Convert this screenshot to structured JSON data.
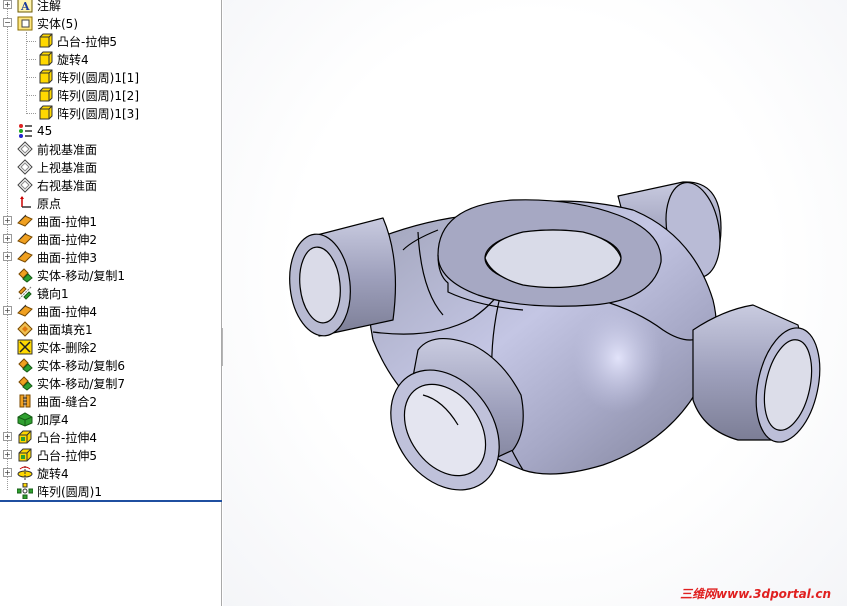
{
  "tree": {
    "items": [
      {
        "label": "注解",
        "icon": "annotation-icon"
      },
      {
        "label": "实体(5)",
        "icon": "solid-bodies-folder-icon"
      },
      {
        "label": "凸台-拉伸5",
        "icon": "solid-body-icon"
      },
      {
        "label": "旋转4",
        "icon": "solid-body-icon"
      },
      {
        "label": "阵列(圆周)1[1]",
        "icon": "solid-body-icon"
      },
      {
        "label": "阵列(圆周)1[2]",
        "icon": "solid-body-icon"
      },
      {
        "label": "阵列(圆周)1[3]",
        "icon": "solid-body-icon"
      },
      {
        "label": "45",
        "icon": "material-icon"
      },
      {
        "label": "前视基准面",
        "icon": "plane-icon"
      },
      {
        "label": "上视基准面",
        "icon": "plane-icon"
      },
      {
        "label": "右视基准面",
        "icon": "plane-icon"
      },
      {
        "label": "原点",
        "icon": "origin-icon"
      },
      {
        "label": "曲面-拉伸1",
        "icon": "surface-extrude-icon"
      },
      {
        "label": "曲面-拉伸2",
        "icon": "surface-extrude-icon"
      },
      {
        "label": "曲面-拉伸3",
        "icon": "surface-extrude-icon"
      },
      {
        "label": "实体-移动/复制1",
        "icon": "move-copy-icon"
      },
      {
        "label": "镜向1",
        "icon": "mirror-icon"
      },
      {
        "label": "曲面-拉伸4",
        "icon": "surface-extrude-icon"
      },
      {
        "label": "曲面填充1",
        "icon": "surface-fill-icon"
      },
      {
        "label": "实体-删除2",
        "icon": "delete-body-icon"
      },
      {
        "label": "实体-移动/复制6",
        "icon": "move-copy-icon"
      },
      {
        "label": "实体-移动/复制7",
        "icon": "move-copy-icon"
      },
      {
        "label": "曲面-缝合2",
        "icon": "knit-surface-icon"
      },
      {
        "label": "加厚4",
        "icon": "thicken-icon"
      },
      {
        "label": "凸台-拉伸4",
        "icon": "boss-extrude-icon"
      },
      {
        "label": "凸台-拉伸5",
        "icon": "boss-extrude-icon"
      },
      {
        "label": "旋转4",
        "icon": "revolve-icon"
      },
      {
        "label": "阵列(圆周)1",
        "icon": "circular-pattern-icon"
      }
    ]
  },
  "viewport": {
    "model": "four-way-pipe-cross-model",
    "watermark": "三维网www.3dportal.cn"
  },
  "colors": {
    "model_fill": "#a3a6c0",
    "model_edge": "#000000",
    "tree_selection_line": "#1f4fa0",
    "watermark": "#e02020"
  }
}
